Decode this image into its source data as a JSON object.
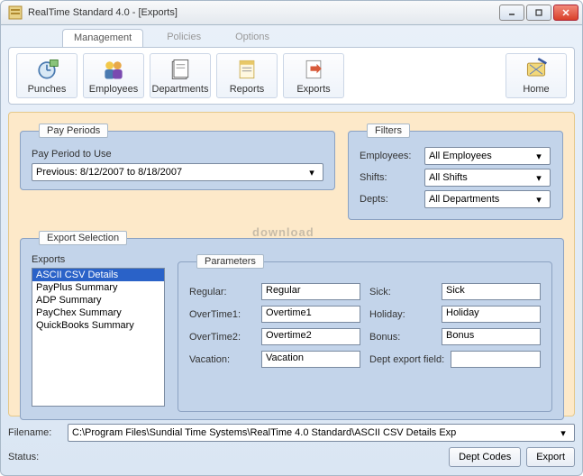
{
  "window": {
    "title": "RealTime Standard 4.0 - [Exports]"
  },
  "tabs": {
    "management": "Management",
    "policies": "Policies",
    "options": "Options"
  },
  "toolbar": {
    "punches": "Punches",
    "employees": "Employees",
    "departments": "Departments",
    "reports": "Reports",
    "exports": "Exports",
    "home": "Home"
  },
  "pay_periods": {
    "legend": "Pay Periods",
    "label": "Pay Period to Use",
    "value": "Previous: 8/12/2007 to 8/18/2007"
  },
  "filters": {
    "legend": "Filters",
    "employees_label": "Employees:",
    "employees_value": "All Employees",
    "shifts_label": "Shifts:",
    "shifts_value": "All Shifts",
    "depts_label": "Depts:",
    "depts_value": "All Departments"
  },
  "export_selection": {
    "legend": "Export Selection",
    "list_label": "Exports",
    "items": [
      "ASCII CSV Details",
      "PayPlus Summary",
      "ADP Summary",
      "PayChex Summary",
      "QuickBooks Summary"
    ],
    "selected_index": 0
  },
  "parameters": {
    "legend": "Parameters",
    "regular_label": "Regular:",
    "regular_value": "Regular",
    "overtime1_label": "OverTime1:",
    "overtime1_value": "Overtime1",
    "overtime2_label": "OverTime2:",
    "overtime2_value": "Overtime2",
    "vacation_label": "Vacation:",
    "vacation_value": "Vacation",
    "sick_label": "Sick:",
    "sick_value": "Sick",
    "holiday_label": "Holiday:",
    "holiday_value": "Holiday",
    "bonus_label": "Bonus:",
    "bonus_value": "Bonus",
    "dept_label": "Dept export field:",
    "dept_value": ""
  },
  "filename": {
    "label": "Filename:",
    "value": "C:\\Program Files\\Sundial Time Systems\\RealTime 4.0 Standard\\ASCII CSV Details Exp"
  },
  "status": {
    "label": "Status:",
    "value": ""
  },
  "buttons": {
    "dept_codes": "Dept Codes",
    "export": "Export"
  },
  "watermark": "download"
}
